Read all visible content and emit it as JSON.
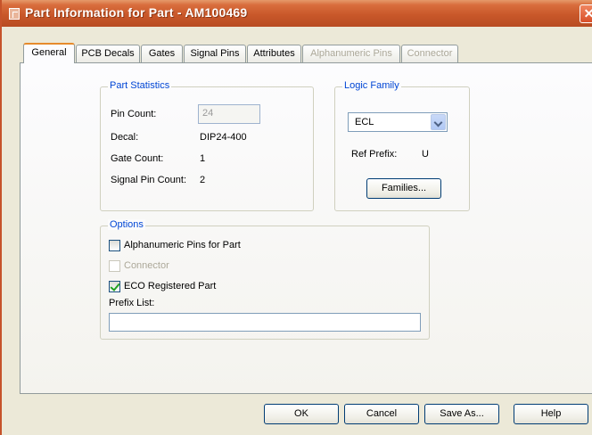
{
  "window": {
    "title": "Part Information for Part - AM100469",
    "close_glyph": "✕"
  },
  "tabs": [
    {
      "label": "General",
      "active": true,
      "enabled": true
    },
    {
      "label": "PCB Decals",
      "active": false,
      "enabled": true
    },
    {
      "label": "Gates",
      "active": false,
      "enabled": true
    },
    {
      "label": "Signal Pins",
      "active": false,
      "enabled": true
    },
    {
      "label": "Attributes",
      "active": false,
      "enabled": true
    },
    {
      "label": "Alphanumeric Pins",
      "active": false,
      "enabled": false
    },
    {
      "label": "Connector",
      "active": false,
      "enabled": false
    }
  ],
  "part_statistics": {
    "legend": "Part Statistics",
    "pin_count_label": "Pin Count:",
    "pin_count_value": "24",
    "decal_label": "Decal:",
    "decal_value": "DIP24-400",
    "gate_count_label": "Gate Count:",
    "gate_count_value": "1",
    "signal_pin_count_label": "Signal Pin Count:",
    "signal_pin_count_value": "2"
  },
  "logic_family": {
    "legend": "Logic Family",
    "selected": "ECL",
    "ref_prefix_label": "Ref Prefix:",
    "ref_prefix_value": "U",
    "families_button": "Families..."
  },
  "options": {
    "legend": "Options",
    "alphanumeric_pins": {
      "label": "Alphanumeric Pins for Part",
      "checked": false,
      "enabled": true
    },
    "connector": {
      "label": "Connector",
      "checked": false,
      "enabled": false
    },
    "eco_registered": {
      "label": "ECO Registered Part",
      "checked": true,
      "enabled": true
    },
    "prefix_list_label": "Prefix List:",
    "prefix_list_value": ""
  },
  "buttons": {
    "ok": "OK",
    "cancel": "Cancel",
    "save_as": "Save As...",
    "help": "Help"
  },
  "colors": {
    "title_bar": "#c9582a",
    "group_legend": "#0046d5",
    "active_tab_accent": "#e68b2c"
  }
}
